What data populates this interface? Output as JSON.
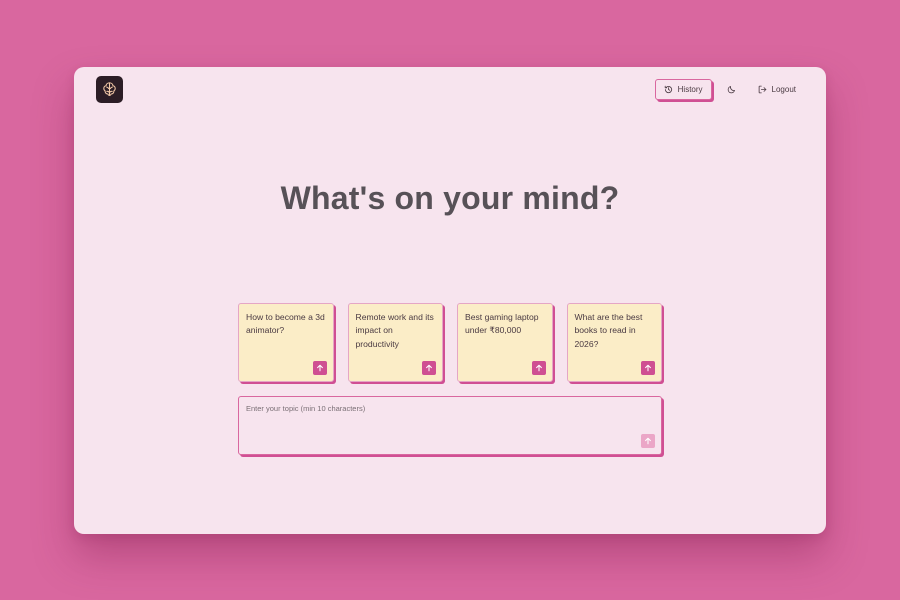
{
  "colors": {
    "background": "#d9679f",
    "window": "#f7e4ee",
    "card": "#fbedc7",
    "accent": "#cf4f92",
    "heading": "#575157"
  },
  "header": {
    "logo_icon": "app-logo-icon",
    "history_label": "History",
    "history_icon": "history-icon",
    "theme_icon": "moon-icon",
    "logout_label": "Logout",
    "logout_icon": "logout-icon"
  },
  "main": {
    "headline": "What's on your mind?",
    "suggestions": [
      {
        "text": "How to become a 3d animator?"
      },
      {
        "text": "Remote work and its impact on productivity"
      },
      {
        "text": "Best gaming laptop under ₹80,000"
      },
      {
        "text": "What are the best books to read in 2026?"
      }
    ],
    "topic_input": {
      "placeholder": "Enter your topic (min 10 characters)",
      "value": ""
    }
  }
}
